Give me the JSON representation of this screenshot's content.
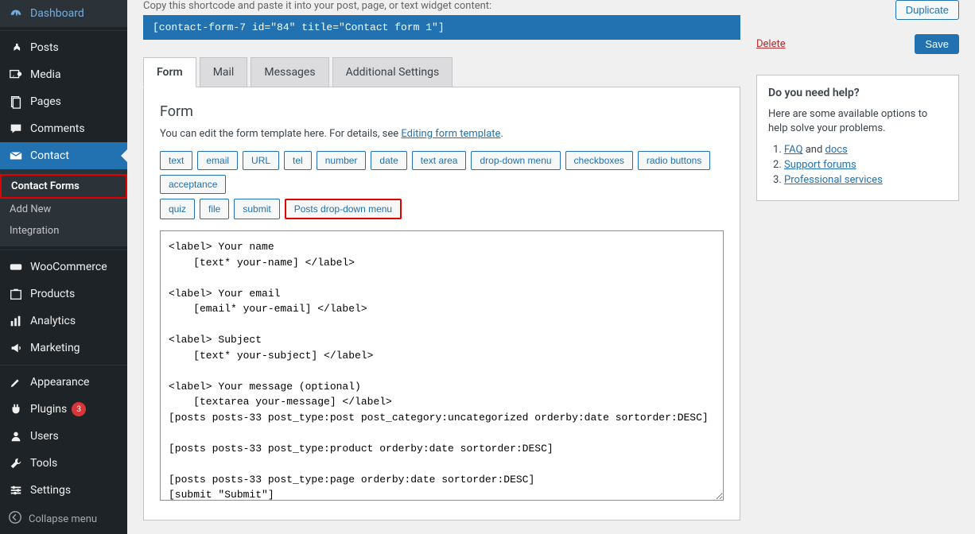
{
  "sidebar": {
    "items": [
      {
        "label": "Dashboard",
        "icon": "dashboard"
      },
      {
        "label": "Posts",
        "icon": "pin"
      },
      {
        "label": "Media",
        "icon": "media"
      },
      {
        "label": "Pages",
        "icon": "pages"
      },
      {
        "label": "Comments",
        "icon": "comments"
      },
      {
        "label": "Contact",
        "icon": "mail",
        "current": true,
        "sub": [
          {
            "label": "Contact Forms",
            "active": true,
            "hl": true
          },
          {
            "label": "Add New"
          },
          {
            "label": "Integration"
          }
        ]
      },
      {
        "label": "WooCommerce",
        "icon": "woo"
      },
      {
        "label": "Products",
        "icon": "products"
      },
      {
        "label": "Analytics",
        "icon": "analytics"
      },
      {
        "label": "Marketing",
        "icon": "marketing"
      },
      {
        "label": "Appearance",
        "icon": "appearance"
      },
      {
        "label": "Plugins",
        "icon": "plugins",
        "badge": "3"
      },
      {
        "label": "Users",
        "icon": "users"
      },
      {
        "label": "Tools",
        "icon": "tools"
      },
      {
        "label": "Settings",
        "icon": "settings"
      }
    ],
    "collapse": "Collapse menu"
  },
  "shortcode": {
    "hint": "Copy this shortcode and paste it into your post, page, or text widget content:",
    "code": "[contact-form-7 id=\"84\" title=\"Contact form 1\"]"
  },
  "tabs": [
    "Form",
    "Mail",
    "Messages",
    "Additional Settings"
  ],
  "form_panel": {
    "heading": "Form",
    "desc_prefix": "You can edit the form template here. For details, see ",
    "desc_link": "Editing form template",
    "tags": [
      "text",
      "email",
      "URL",
      "tel",
      "number",
      "date",
      "text area",
      "drop-down menu",
      "checkboxes",
      "radio buttons",
      "acceptance",
      "quiz",
      "file",
      "submit",
      "Posts drop-down menu"
    ],
    "textarea": "<label> Your name\n    [text* your-name] </label>\n\n<label> Your email\n    [email* your-email] </label>\n\n<label> Subject\n    [text* your-subject] </label>\n\n<label> Your message (optional)\n    [textarea your-message] </label>\n[posts posts-33 post_type:post post_category:uncategorized orderby:date sortorder:DESC]\n\n[posts posts-33 post_type:product orderby:date sortorder:DESC]\n\n[posts posts-33 post_type:page orderby:date sortorder:DESC]\n[submit \"Submit\"]"
  },
  "aside": {
    "duplicate": "Duplicate",
    "delete": "Delete",
    "save": "Save",
    "help": {
      "title": "Do you need help?",
      "desc": "Here are some available options to help solve your problems.",
      "items": [
        {
          "link1": "FAQ",
          "mid": " and ",
          "link2": "docs"
        },
        {
          "link1": "Support forums"
        },
        {
          "link1": "Professional services"
        }
      ]
    }
  }
}
